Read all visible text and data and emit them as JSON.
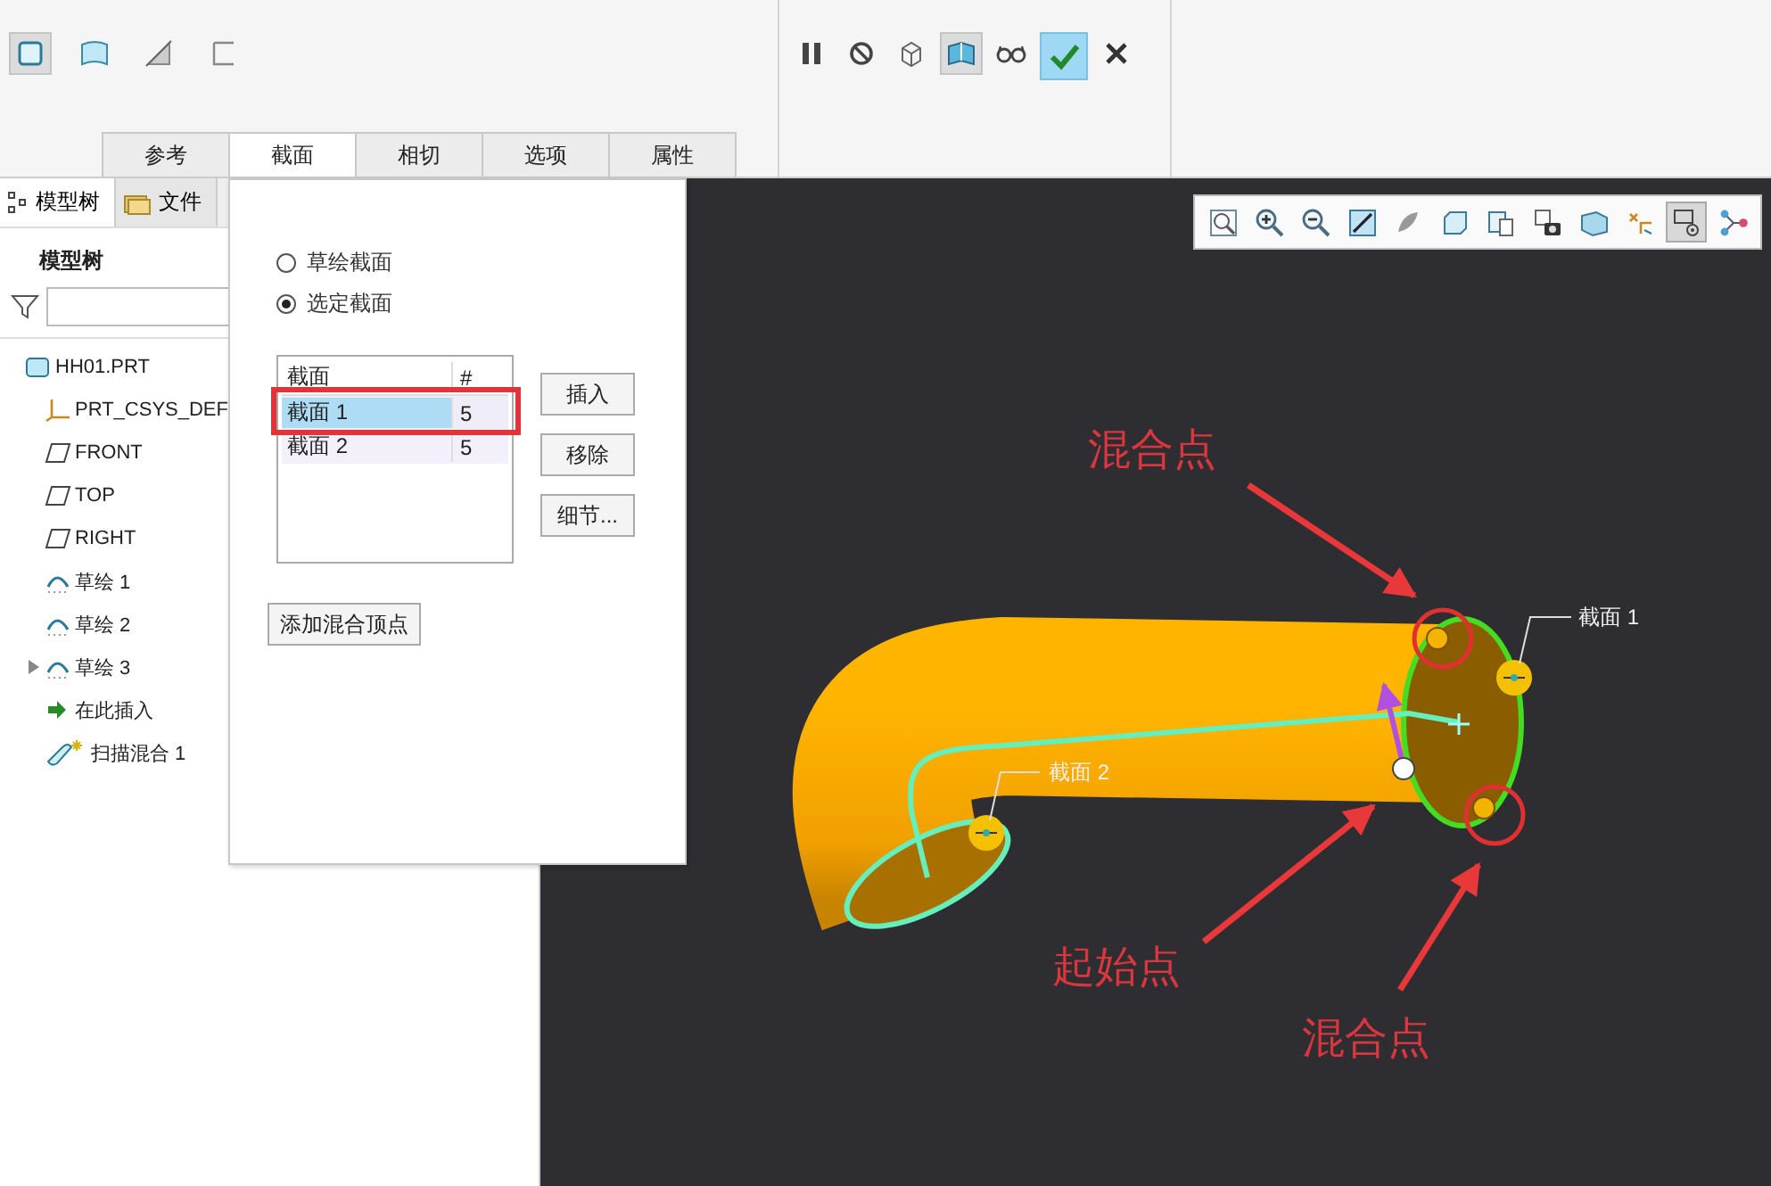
{
  "ribbon": {
    "shape_icons": [
      {
        "kind": "solid",
        "selected": true
      },
      {
        "kind": "surface",
        "selected": false
      },
      {
        "kind": "cut",
        "selected": false
      },
      {
        "kind": "thin",
        "selected": false
      }
    ],
    "control_icons": [
      {
        "kind": "pause",
        "selected": false
      },
      {
        "kind": "stop",
        "selected": false
      },
      {
        "kind": "wireframe",
        "selected": false
      },
      {
        "kind": "preview",
        "selected": true
      },
      {
        "kind": "glasses",
        "selected": false
      },
      {
        "kind": "confirm",
        "selected": true
      },
      {
        "kind": "cancel",
        "selected": false
      }
    ],
    "tabs": [
      {
        "label": "参考",
        "selected": false
      },
      {
        "label": "截面",
        "selected": true
      },
      {
        "label": "相切",
        "selected": false
      },
      {
        "label": "选项",
        "selected": false
      },
      {
        "label": "属性",
        "selected": false
      }
    ]
  },
  "model_tree": {
    "tabs": [
      {
        "label": "模型树",
        "kind": "tree",
        "selected": true
      },
      {
        "label": "文件",
        "kind": "folder",
        "selected": false
      }
    ],
    "heading": "模型树",
    "items": [
      {
        "label": "HH01.PRT",
        "kind": "part",
        "children": [
          {
            "label": "PRT_CSYS_DEF",
            "kind": "csys"
          },
          {
            "label": "FRONT",
            "kind": "plane"
          },
          {
            "label": "TOP",
            "kind": "plane"
          },
          {
            "label": "RIGHT",
            "kind": "plane"
          },
          {
            "label": "草绘 1",
            "kind": "sketch"
          },
          {
            "label": "草绘 2",
            "kind": "sketch"
          },
          {
            "label": "草绘 3",
            "kind": "sketch",
            "expanded": false
          },
          {
            "label": "在此插入",
            "kind": "insert"
          },
          {
            "label": "扫描混合 1",
            "kind": "sweep"
          }
        ]
      }
    ]
  },
  "sections_panel": {
    "options": [
      {
        "label": "草绘截面",
        "selected": false
      },
      {
        "label": "选定截面",
        "selected": true
      }
    ],
    "table": {
      "columns": [
        "截面",
        "#"
      ],
      "rows": [
        {
          "cells": [
            "截面 1",
            "5"
          ],
          "selected": true
        },
        {
          "cells": [
            "截面 2",
            "5"
          ],
          "selected": false
        }
      ]
    },
    "buttons": [
      "插入",
      "移除",
      "细节..."
    ],
    "add_vertex_button": "添加混合顶点"
  },
  "viewport": {
    "toolbar": [
      {
        "kind": "refit",
        "selected": false
      },
      {
        "kind": "zoom_in",
        "selected": false
      },
      {
        "kind": "zoom_out",
        "selected": false
      },
      {
        "kind": "repaint",
        "selected": false
      },
      {
        "kind": "display_style",
        "selected": false
      },
      {
        "kind": "saved_views",
        "selected": false
      },
      {
        "kind": "view_manager",
        "selected": false
      },
      {
        "kind": "perspective",
        "selected": false
      },
      {
        "kind": "section",
        "selected": false
      },
      {
        "kind": "datum_display",
        "selected": false
      },
      {
        "kind": "annotation_display",
        "selected": true
      },
      {
        "kind": "spin_center",
        "selected": false
      }
    ],
    "section_labels": [
      "截面 1",
      "截面 2"
    ],
    "callouts": [
      {
        "label": "混合点",
        "kind": "blend_top"
      },
      {
        "label": "起始点",
        "kind": "start"
      },
      {
        "label": "混合点",
        "kind": "blend_bottom"
      }
    ]
  }
}
